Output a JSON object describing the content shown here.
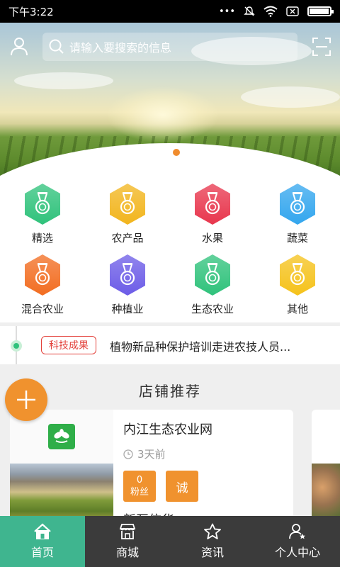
{
  "status_bar": {
    "time": "下午3:22"
  },
  "header": {
    "search_placeholder": "请输入要搜索的信息"
  },
  "banner": {
    "dots": 2,
    "active_dot": 2
  },
  "categories": [
    {
      "label": "精选",
      "color": "#2fc27b"
    },
    {
      "label": "农产品",
      "color": "#f2b51d"
    },
    {
      "label": "水果",
      "color": "#e8364d"
    },
    {
      "label": "蔬菜",
      "color": "#33a6ee"
    },
    {
      "label": "混合农业",
      "color": "#f26d21"
    },
    {
      "label": "种植业",
      "color": "#6c5ce7"
    },
    {
      "label": "生态农业",
      "color": "#2fc27b"
    },
    {
      "label": "其他",
      "color": "#f5c21b"
    }
  ],
  "ticker": {
    "tag": "科技成果",
    "text": "植物新品种保护培训走进农技人员..."
  },
  "shops": {
    "section_title": "店铺推荐",
    "items": [
      {
        "name": "内江生态农业网",
        "time": "3天前",
        "fans_count": "0",
        "fans_label": "粉丝",
        "badge": "诚",
        "next_title": "新互信华"
      }
    ]
  },
  "bottom_nav": [
    {
      "label": "首页",
      "icon": "home-icon",
      "active": true
    },
    {
      "label": "商城",
      "icon": "store-icon",
      "active": false
    },
    {
      "label": "资讯",
      "icon": "star-icon",
      "active": false
    },
    {
      "label": "个人中心",
      "icon": "user-star-icon",
      "active": false
    }
  ],
  "colors": {
    "accent_orange": "#f0922e",
    "nav_active": "#3fb58f",
    "nav_bg": "#3b3b3b",
    "tag_red": "#e3413b"
  }
}
